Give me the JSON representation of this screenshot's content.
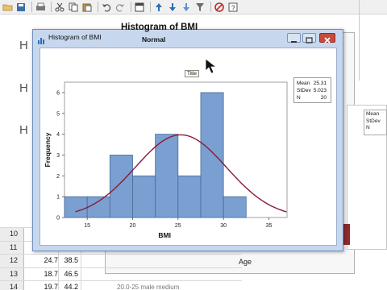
{
  "toolbar": {
    "icons": [
      "open-icon",
      "save-icon",
      "print-icon",
      "cut-icon",
      "copy-icon",
      "paste-icon",
      "undo-icon",
      "redo-icon",
      "window-icon",
      "up-icon",
      "down-icon",
      "down-alt-icon",
      "filter-icon",
      "cancel-icon",
      "help-icon"
    ],
    "colors": {
      "accent": "#2f6db5",
      "cancel": "#c62828"
    }
  },
  "background": {
    "side_letters": [
      "H",
      "H",
      "H"
    ],
    "stats_labels": [
      "Mean",
      "StDev",
      "N"
    ],
    "axis_label": "Age"
  },
  "worksheet": {
    "rows": [
      {
        "num": "10",
        "c1": "",
        "c2": "",
        "c3": ""
      },
      {
        "num": "11",
        "c1": "",
        "c2": "",
        "c3": ""
      },
      {
        "num": "12",
        "c1": "24.7",
        "c2": "38.5",
        "c3": ""
      },
      {
        "num": "13",
        "c1": "18.7",
        "c2": "46.5",
        "c3": ""
      },
      {
        "num": "14",
        "c1": "19.7",
        "c2": "44.2",
        "c3": "20.0-25 male medium"
      }
    ]
  },
  "window": {
    "title": "Histogram of BMI",
    "title_color": "#c7d8ee"
  },
  "chart": {
    "tooltip": "Title",
    "stats": {
      "mean_label": "Mean",
      "mean_value": "25.31",
      "stdev_label": "StDev",
      "stdev_value": "5.023",
      "n_label": "N",
      "n_value": "20"
    }
  },
  "chart_data": {
    "type": "bar",
    "title": "Histogram of BMI",
    "subtitle": "Normal",
    "xlabel": "BMI",
    "ylabel": "Frequency",
    "bin_edges": [
      12.5,
      15,
      17.5,
      20,
      22.5,
      25,
      27.5,
      30,
      32.5,
      35
    ],
    "values": [
      1,
      1,
      3,
      2,
      4,
      2,
      6,
      1,
      0
    ],
    "xticks": [
      15,
      20,
      25,
      30,
      35
    ],
    "yticks": [
      0,
      1,
      2,
      3,
      4,
      5,
      6
    ],
    "xlim": [
      12.5,
      37
    ],
    "ylim": [
      0,
      6.5
    ],
    "fit": {
      "type": "normal",
      "mean": 25.31,
      "stdev": 5.023
    },
    "bar_color": "#7a9fd1",
    "bar_edge_color": "#4a6a99",
    "curve_color": "#8b1a3a"
  }
}
